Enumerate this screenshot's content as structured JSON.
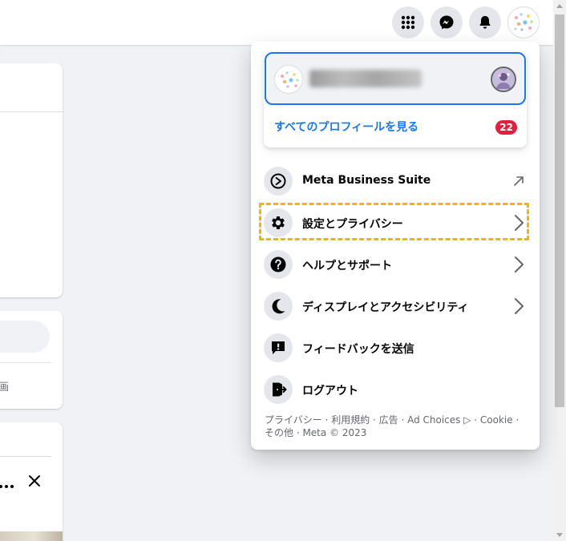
{
  "topbar": {
    "buttons": [
      {
        "name": "menu-grid",
        "icon": "grid-icon"
      },
      {
        "name": "messenger",
        "icon": "messenger-icon"
      },
      {
        "name": "notifications",
        "icon": "bell-icon"
      },
      {
        "name": "account",
        "icon": "profile-avatar-icon"
      }
    ]
  },
  "background": {
    "snippet_text": "画"
  },
  "account_menu": {
    "profile": {
      "name": "■■■■■■ ■■■",
      "see_all_label": "すべてのプロフィールを見る",
      "badge_count": "22"
    },
    "items": [
      {
        "label": "Meta Business Suite",
        "icon": "meta-business-suite-icon",
        "trailing": "external-arrow"
      },
      {
        "label": "設定とプライバシー",
        "icon": "gear-icon",
        "trailing": "chevron",
        "highlighted": true
      },
      {
        "label": "ヘルプとサポート",
        "icon": "question-icon",
        "trailing": "chevron"
      },
      {
        "label": "ディスプレイとアクセシビリティ",
        "icon": "moon-icon",
        "trailing": "chevron"
      },
      {
        "label": "フィードバックを送信",
        "icon": "feedback-icon",
        "trailing": "none"
      },
      {
        "label": "ログアウト",
        "icon": "logout-icon",
        "trailing": "none"
      }
    ],
    "footer": {
      "line1": "プライバシー · 利用規約 · 広告 · Ad Choices ▷ · Cookie ·",
      "line2": "その他 · Meta © 2023"
    }
  },
  "colors": {
    "accent": "#1877f2",
    "badge": "#e41e3f",
    "highlight": "#f5b400",
    "icon_bg": "#e4e6eb"
  }
}
